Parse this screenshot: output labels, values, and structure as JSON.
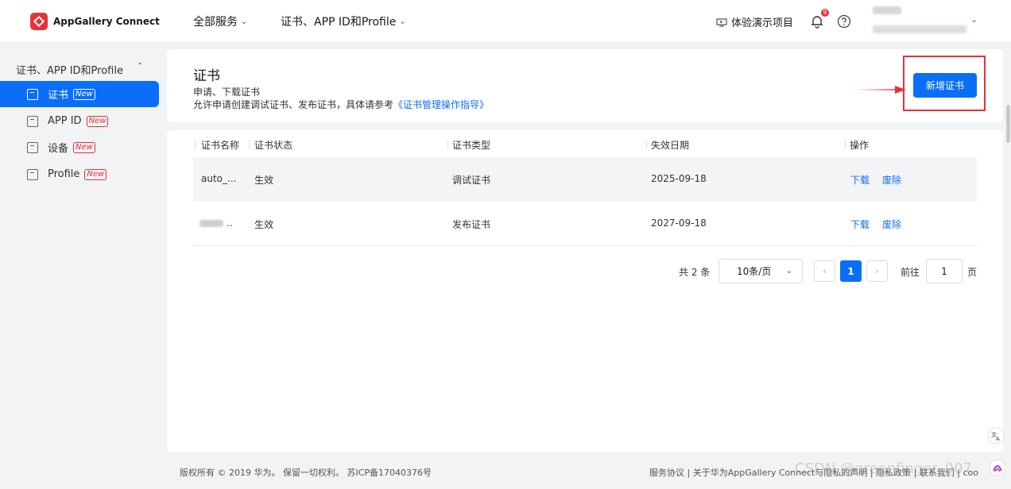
{
  "topbar": {
    "app_name": "AppGallery Connect",
    "nav": [
      {
        "label": "全部服务"
      },
      {
        "label": "证书、APP ID和Profile"
      }
    ],
    "demo_label": "体验演示项目",
    "notification_count": "9"
  },
  "sidebar": {
    "section_label": "证书、APP ID和Profile",
    "items": [
      {
        "label": "证书",
        "tag": "New"
      },
      {
        "label": "APP ID",
        "tag": "New"
      },
      {
        "label": "设备",
        "tag": "New"
      },
      {
        "label": "Profile",
        "tag": "New"
      }
    ]
  },
  "header": {
    "title": "证书",
    "subtitle1": "申请、下载证书",
    "subtitle2_prefix": "允许申请创建调试证书、发布证书，具体请参考",
    "subtitle2_link": "《证书管理操作指导》",
    "add_button": "新增证书"
  },
  "table": {
    "columns": [
      "证书名称",
      "证书状态",
      "证书类型",
      "失效日期",
      "操作"
    ],
    "rows": [
      {
        "name": "auto_...",
        "status": "生效",
        "type": "调试证书",
        "expiry": "2025-09-18",
        "action_download": "下载",
        "action_revoke": "废除"
      },
      {
        "name": "..",
        "status": "生效",
        "type": "发布证书",
        "expiry": "2027-09-18",
        "action_download": "下载",
        "action_revoke": "废除"
      }
    ]
  },
  "pagination": {
    "total": "共 2 条",
    "page_size": "10条/页",
    "current_page": "1",
    "goto_label": "前往",
    "goto_value": "1",
    "page_unit": "页"
  },
  "footer": {
    "copyright": "版权所有 © 2019 华为。 保留一切权利。 苏ICP备17040376号",
    "links": "服务协议 | 关于华为AppGallery Connect与隐私的声明 | 隐私政策 | 联系我们 | coo",
    "watermark": "CSDN @greenfinger_007"
  },
  "colors": {
    "accent": "#0a6ff6",
    "brand": "#e8313a"
  }
}
